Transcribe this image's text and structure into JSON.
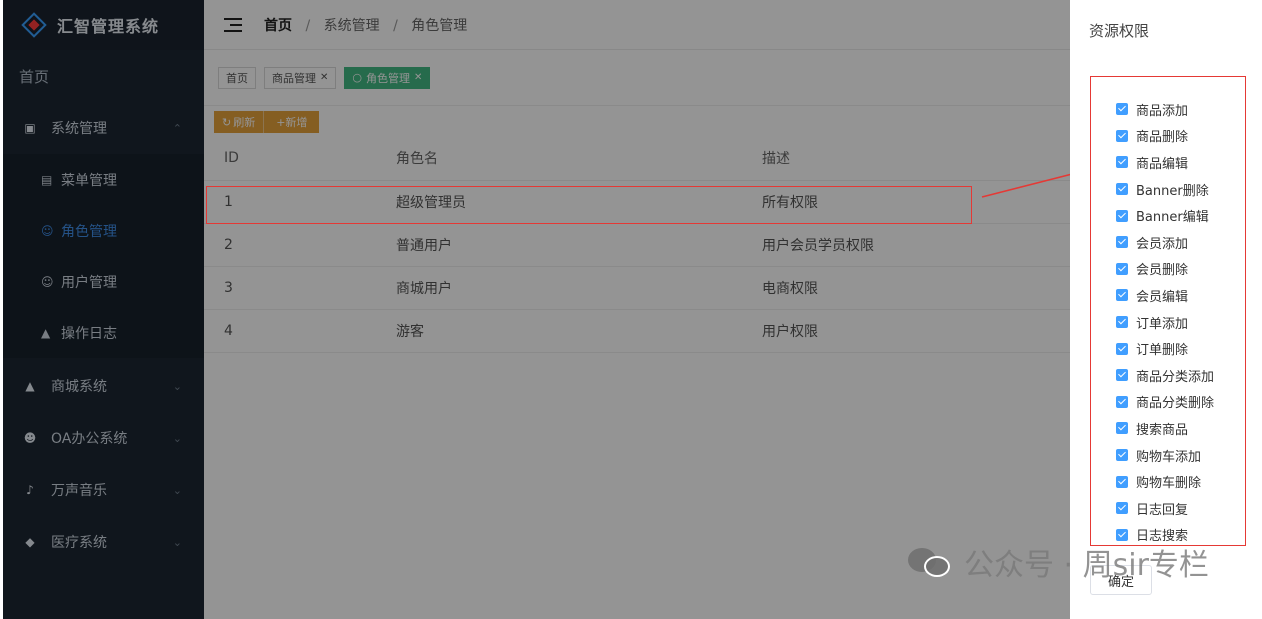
{
  "app": {
    "title": "汇智管理系统"
  },
  "sidebar": {
    "home": "首页",
    "system_group": {
      "label": "系统管理"
    },
    "sub_items": [
      {
        "label": "菜单管理",
        "icon": "menu-list-icon",
        "active": false
      },
      {
        "label": "角色管理",
        "icon": "role-user-icon",
        "active": true
      },
      {
        "label": "用户管理",
        "icon": "user-icon",
        "active": false
      },
      {
        "label": "操作日志",
        "icon": "home-icon",
        "active": false
      }
    ],
    "groups": [
      {
        "label": "商城系统",
        "icon": "shop-icon"
      },
      {
        "label": "OA办公系统",
        "icon": "team-icon"
      },
      {
        "label": "万声音乐",
        "icon": "music-icon"
      },
      {
        "label": "医疗系统",
        "icon": "shield-icon"
      }
    ]
  },
  "header": {
    "breadcrumb": [
      "首页",
      "系统管理",
      "角色管理"
    ],
    "separator": "/"
  },
  "tabs": [
    {
      "label": "首页",
      "closable": false,
      "active": false
    },
    {
      "label": "商品管理",
      "closable": true,
      "active": false
    },
    {
      "label": "角色管理",
      "closable": true,
      "active": true
    }
  ],
  "toolbar": {
    "refresh_label": "刷新",
    "add_label": "+新增"
  },
  "table": {
    "columns": [
      "ID",
      "角色名",
      "描述"
    ],
    "rows": [
      [
        "1",
        "超级管理员",
        "所有权限"
      ],
      [
        "2",
        "普通用户",
        "用户会员学员权限"
      ],
      [
        "3",
        "商城用户",
        "电商权限"
      ],
      [
        "4",
        "游客",
        "用户权限"
      ]
    ]
  },
  "drawer": {
    "title": "资源权限",
    "permissions": [
      {
        "label": "商品添加",
        "checked": true
      },
      {
        "label": "商品删除",
        "checked": true
      },
      {
        "label": "商品编辑",
        "checked": true
      },
      {
        "label": "Banner删除",
        "checked": true
      },
      {
        "label": "Banner编辑",
        "checked": true
      },
      {
        "label": "会员添加",
        "checked": true
      },
      {
        "label": "会员删除",
        "checked": true
      },
      {
        "label": "会员编辑",
        "checked": true
      },
      {
        "label": "订单添加",
        "checked": true
      },
      {
        "label": "订单删除",
        "checked": true
      },
      {
        "label": "商品分类添加",
        "checked": true
      },
      {
        "label": "商品分类删除",
        "checked": true
      },
      {
        "label": "搜索商品",
        "checked": true
      },
      {
        "label": "购物车添加",
        "checked": true
      },
      {
        "label": "购物车删除",
        "checked": true
      },
      {
        "label": "日志回复",
        "checked": true
      },
      {
        "label": "日志搜索",
        "checked": true
      }
    ],
    "confirm_label": "确定"
  },
  "watermark": {
    "text": "公众号 · 周sir专栏"
  },
  "colors": {
    "sidebar_bg": "#1c2632",
    "active_menu": "#3f8ee8",
    "active_tag": "#42b983",
    "toolbar_button": "#e6a23c",
    "checkbox": "#409eff",
    "annotation": "#e53935"
  }
}
